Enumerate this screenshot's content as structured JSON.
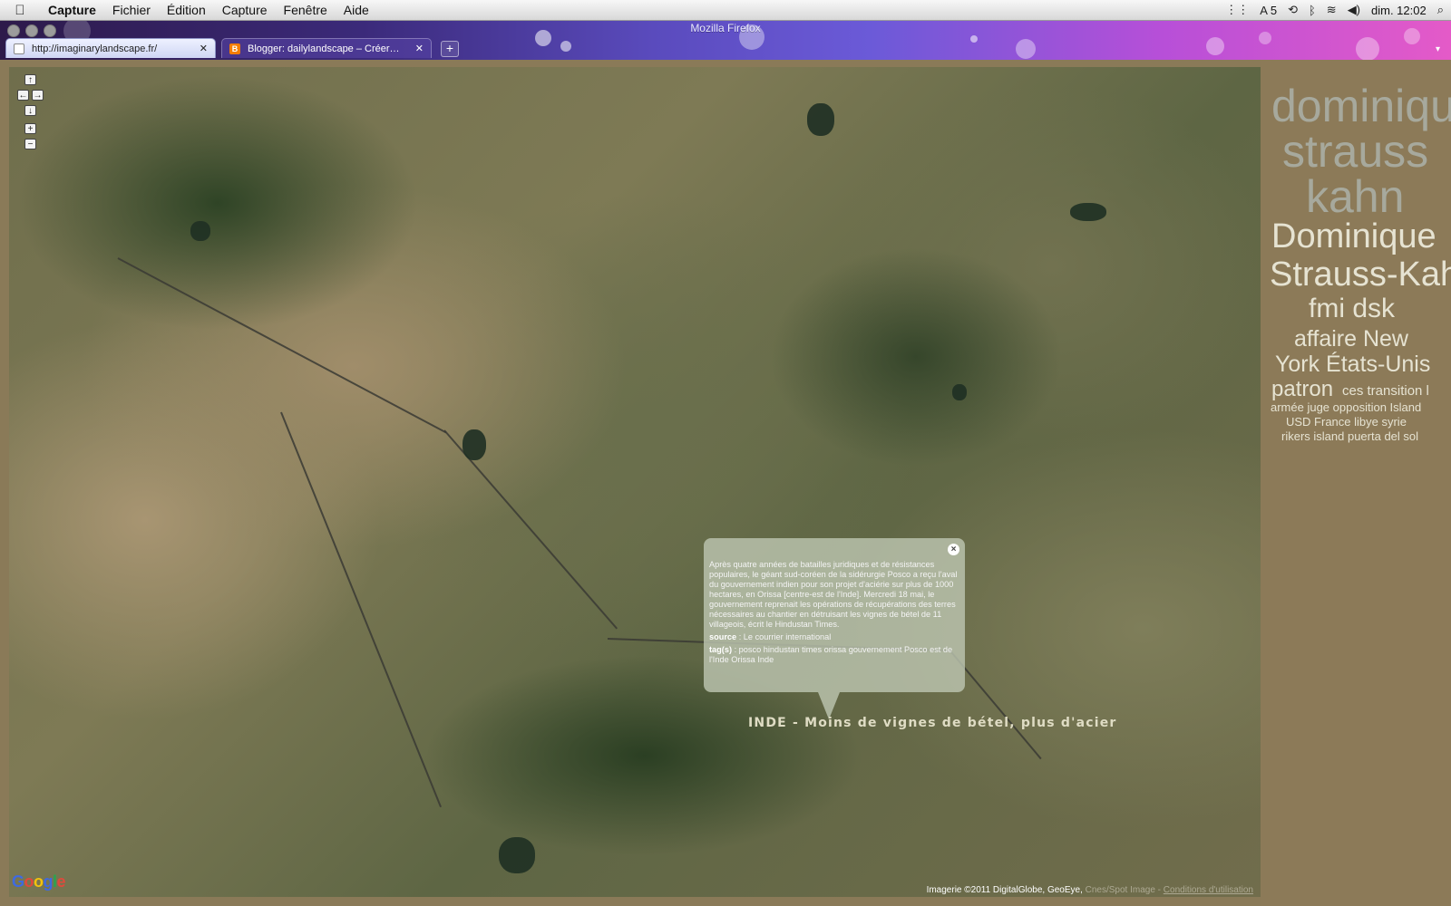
{
  "menubar": {
    "app_name": "Capture",
    "items": [
      "Fichier",
      "Édition",
      "Capture",
      "Fenêtre",
      "Aide"
    ],
    "status": {
      "adobe_count": "5",
      "clock": "dim. 12:02"
    }
  },
  "window": {
    "title": "Mozilla Firefox",
    "tabs": [
      {
        "label": "http://imaginarylandscape.fr/",
        "active": true
      },
      {
        "label": "Blogger: dailylandscape – Créer…",
        "active": false
      }
    ],
    "new_tab_label": "+"
  },
  "map": {
    "controls": {
      "up": "↑",
      "left": "←",
      "right": "→",
      "down": "↓",
      "zoom_in": "+",
      "zoom_out": "−"
    },
    "logo": "Google",
    "attribution": {
      "imagery": "Imagerie ©2011 DigitalGlobe, GeoEye,",
      "faded": "Cnes/Spot Image -",
      "terms_link": "Conditions d'utilisation"
    },
    "title_label": "INDE - Moins de vignes de bétel, plus d'acier"
  },
  "infowindow": {
    "close": "×",
    "body": "Après quatre années de batailles juridiques et de résistances populaires, le géant sud-coréen de la sidérurgie Posco a reçu l'aval du gouvernement indien pour son projet d'aciérie sur plus de 1000 hectares, en Orissa [centre-est de l'Inde]. Mercredi 18 mai, le gouvernement reprenait les opérations de récupérations des terres nécessaires au chantier en détruisant les vignes de bétel de 11 villageois, écrit le Hindustan Times.",
    "source_label": "source",
    "source_value": " : Le courrier international",
    "tags_label": "tag(s)",
    "tags_value": " : posco hindustan times orissa gouvernement Posco est de l'Inde Orissa Inde"
  },
  "tag_cloud": {
    "dominique_lower": "dominique",
    "strauss_lower": "strauss",
    "kahn_lower": "kahn",
    "dominique_cap": "Dominique",
    "strauss_kahn": "Strauss-Kahn",
    "fmi_dsk": "fmi dsk",
    "affaire_new": "affaire New",
    "york_etats_unis": "York États-Unis",
    "patron": "patron",
    "ces_transition": "ces  transition  l",
    "line_armee": "armée  juge  opposition  Island",
    "line_usd": "USD  France  libye  syrie",
    "line_rikers": "rikers island  puerta del sol"
  },
  "colors": {
    "page_bg": "#8a7a58",
    "bubble_bg": "#bcc4b0",
    "cloud_text": "#e6e3d2",
    "cloud_dim": "#a7a99d"
  }
}
